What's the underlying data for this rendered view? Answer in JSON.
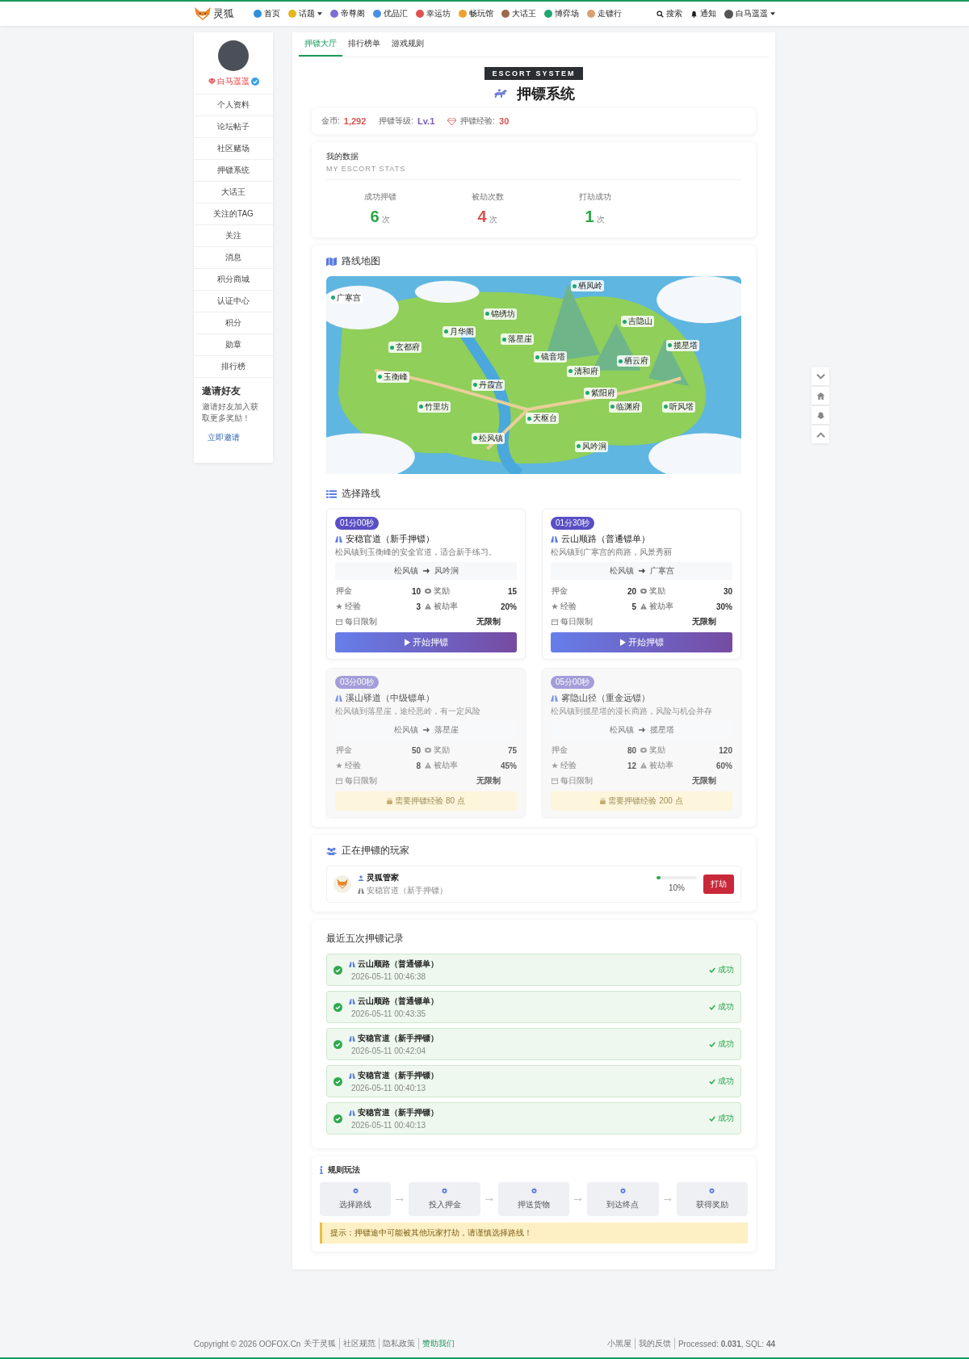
{
  "nav": {
    "logo": "灵狐",
    "items": [
      {
        "label": "首页",
        "dropdown": false,
        "color": "#2f8fd8"
      },
      {
        "label": "话题",
        "dropdown": true,
        "color": "#e6b422"
      },
      {
        "label": "帝尊阁",
        "dropdown": false,
        "color": "#7b6fd6"
      },
      {
        "label": "优品汇",
        "dropdown": false,
        "color": "#4a90e2"
      },
      {
        "label": "幸运坊",
        "dropdown": false,
        "color": "#e05252"
      },
      {
        "label": "畅玩馆",
        "dropdown": false,
        "color": "#f0a030"
      },
      {
        "label": "大话王",
        "dropdown": false,
        "color": "#9a6b4a"
      },
      {
        "label": "博弈场",
        "dropdown": false,
        "color": "#1fa870"
      },
      {
        "label": "走镖行",
        "dropdown": false,
        "color": "#d8a070"
      }
    ],
    "search": "搜索",
    "notify": "通知",
    "user": "白马遥遥"
  },
  "sidebar": {
    "username": "白马遥遥",
    "verified": true,
    "items": [
      {
        "label": "个人资料",
        "selected": false
      },
      {
        "label": "论坛帖子",
        "selected": false
      },
      {
        "label": "社区赌场",
        "selected": false
      },
      {
        "label": "押镖系统",
        "selected": false
      },
      {
        "label": "大话王",
        "selected": false
      },
      {
        "label": "关注的TAG",
        "selected": false
      },
      {
        "label": "关注",
        "selected": false
      },
      {
        "label": "消息",
        "selected": false
      },
      {
        "label": "积分商城",
        "selected": false
      },
      {
        "label": "认证中心",
        "selected": false
      },
      {
        "label": "积分",
        "selected": false
      },
      {
        "label": "勋章",
        "selected": false
      },
      {
        "label": "排行榜",
        "selected": false
      }
    ],
    "invite": {
      "title": "邀请好友",
      "text": "邀请好友加入获取更多奖励！",
      "link": "立即邀请"
    }
  },
  "tabs": [
    {
      "label": "押镖大厅",
      "selected": true
    },
    {
      "label": "排行榜单",
      "selected": false
    },
    {
      "label": "游戏规则",
      "selected": false
    }
  ],
  "header": {
    "badge": "ESCORT SYSTEM",
    "title": "押镖系统"
  },
  "currency": [
    {
      "label": "金币:",
      "value": "1,292",
      "color": "#d9534f"
    },
    {
      "label": "押镖等级:",
      "value": "Lv.1",
      "color": "#7a5ab8"
    },
    {
      "label": "押镖经验:",
      "value": "30",
      "color": "#d9534f"
    }
  ],
  "my_stats": {
    "title": "我的数据",
    "subtitle": "MY ESCORT STATS",
    "items": [
      {
        "label": "成功押镖",
        "value": "6",
        "unit": "次",
        "color": "#28a745"
      },
      {
        "label": "被劫次数",
        "value": "4",
        "unit": "次",
        "color": "#d9534f"
      },
      {
        "label": "打劫成功",
        "value": "1",
        "unit": "次",
        "color": "#28a745"
      }
    ]
  },
  "map": {
    "title": "路线地图",
    "markers": [
      {
        "label": "栖凤岭"
      },
      {
        "label": "广寒宫"
      },
      {
        "label": "锦绣坊"
      },
      {
        "label": "吉隐山"
      },
      {
        "label": "月华阁"
      },
      {
        "label": "落星崖"
      },
      {
        "label": "玄都府"
      },
      {
        "label": "揽星塔"
      },
      {
        "label": "镜音塔"
      },
      {
        "label": "栖云府"
      },
      {
        "label": "清和府"
      },
      {
        "label": "玉衡峰"
      },
      {
        "label": "丹霞宫"
      },
      {
        "label": "紫阳府"
      },
      {
        "label": "竹里坊"
      },
      {
        "label": "临渊府"
      },
      {
        "label": "听风塔"
      },
      {
        "label": "天枢台"
      },
      {
        "label": "松风镇"
      },
      {
        "label": "风吟涧"
      }
    ]
  },
  "routes": {
    "title": "选择路线",
    "items": [
      {
        "duration": "01分00秒",
        "name": "安稳官道（新手押镖）",
        "description": "松风镇到玉衡峰的安全官道，适合新手练习。",
        "from": "松风镇",
        "to": "风吟涧",
        "stats": [
          {
            "label": "押金",
            "value": "10"
          },
          {
            "label": "奖励",
            "value": "15"
          },
          {
            "label": "经验",
            "value": "3"
          },
          {
            "label": "被劫率",
            "value": "20%"
          },
          {
            "label": "每日限制",
            "value": "无限制"
          }
        ],
        "locked": false,
        "action": "开始押镖"
      },
      {
        "duration": "01分30秒",
        "name": "云山顺路（普通镖单）",
        "description": "松风镇到广寒宫的商路，风景秀丽",
        "from": "松风镇",
        "to": "广寒宫",
        "stats": [
          {
            "label": "押金",
            "value": "20"
          },
          {
            "label": "奖励",
            "value": "30"
          },
          {
            "label": "经验",
            "value": "5"
          },
          {
            "label": "被劫率",
            "value": "30%"
          },
          {
            "label": "每日限制",
            "value": "无限制"
          }
        ],
        "locked": false,
        "action": "开始押镖"
      },
      {
        "duration": "03分00秒",
        "name": "溪山驿道（中级镖单）",
        "description": "松风镇到落星崖，途经恶岭，有一定风险",
        "from": "松风镇",
        "to": "落星崖",
        "stats": [
          {
            "label": "押金",
            "value": "50"
          },
          {
            "label": "奖励",
            "value": "75"
          },
          {
            "label": "经验",
            "value": "8"
          },
          {
            "label": "被劫率",
            "value": "45%"
          },
          {
            "label": "每日限制",
            "value": "无限制"
          }
        ],
        "locked": true,
        "action": "需要押镖经验 80 点"
      },
      {
        "duration": "05分00秒",
        "name": "雾隐山径（重金远镖）",
        "description": "松风镇到揽星塔的漫长商路，风险与机会并存",
        "from": "松风镇",
        "to": "揽星塔",
        "stats": [
          {
            "label": "押金",
            "value": "80"
          },
          {
            "label": "奖励",
            "value": "120"
          },
          {
            "label": "经验",
            "value": "12"
          },
          {
            "label": "被劫率",
            "value": "60%"
          },
          {
            "label": "每日限制",
            "value": "无限制"
          }
        ],
        "locked": true,
        "action": "需要押镖经验 200 点"
      }
    ]
  },
  "players": {
    "title": "正在押镖的玩家",
    "items": [
      {
        "name": "灵狐管家",
        "route": "安稳官道（新手押镖）",
        "level": 0.1,
        "reading": "10%",
        "button": "打劫"
      }
    ]
  },
  "records": {
    "title": "最近五次押镖记录",
    "items": [
      {
        "route": "云山顺路（普通镖单）",
        "time": "2026-05-11 00:46:38",
        "status": "成功",
        "success": true
      },
      {
        "route": "云山顺路（普通镖单）",
        "time": "2026-05-11 00:43:35",
        "status": "成功",
        "success": true
      },
      {
        "route": "安稳官道（新手押镖）",
        "time": "2026-05-11 00:42:04",
        "status": "成功",
        "success": true
      },
      {
        "route": "安稳官道（新手押镖）",
        "time": "2026-05-11 00:40:13",
        "status": "成功",
        "success": true
      },
      {
        "route": "安稳官道（新手押镖）",
        "time": "2026-05-11 00:40:13",
        "status": "成功",
        "success": true
      }
    ]
  },
  "rules": {
    "title": "规则玩法",
    "steps": [
      "选择路线",
      "投入押金",
      "押送货物",
      "到达终点",
      "获得奖励"
    ],
    "tip": "提示：押镖途中可能被其他玩家打劫，请谨慎选择路线！"
  },
  "footer": {
    "copyright": "Copyright © 2026 OOFOX.Cn",
    "left_links": [
      "关于灵狐",
      "社区规范",
      "隐私政策",
      "赞助我们"
    ],
    "right_links": [
      "小黑屋",
      "我的反馈"
    ],
    "processed": "Processed: **0.031**, SQL: **44**"
  }
}
